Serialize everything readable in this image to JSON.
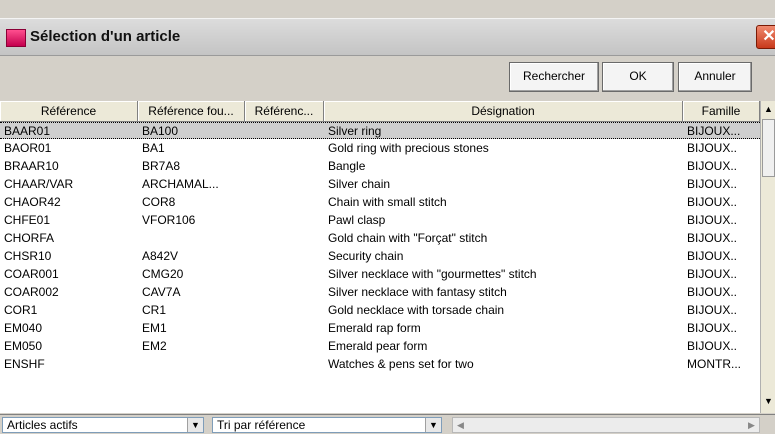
{
  "window": {
    "title": "Sélection d'un article",
    "close_glyph": "✕"
  },
  "toolbar": {
    "search_label": "Rechercher",
    "ok_label": "OK",
    "cancel_label": "Annuler"
  },
  "table": {
    "columns": [
      "Référence",
      "Référence fou...",
      "Référenc...",
      "Désignation",
      "Famille"
    ],
    "rows": [
      [
        "BAAR01",
        "BA100",
        "",
        "Silver ring",
        "BIJOUX..."
      ],
      [
        "BAOR01",
        "BA1",
        "",
        "Gold ring with precious stones",
        "BIJOUX.."
      ],
      [
        "BRAAR10",
        "BR7A8",
        "",
        "Bangle",
        "BIJOUX.."
      ],
      [
        "CHAAR/VAR",
        "ARCHAMAL...",
        "",
        "Silver chain",
        "BIJOUX.."
      ],
      [
        "CHAOR42",
        "COR8",
        "",
        "Chain with small stitch",
        "BIJOUX.."
      ],
      [
        "CHFE01",
        "VFOR106",
        "",
        "Pawl clasp",
        "BIJOUX.."
      ],
      [
        "CHORFA",
        "",
        "",
        "Gold chain with \"Forçat\" stitch",
        "BIJOUX.."
      ],
      [
        "CHSR10",
        "A842V",
        "",
        "Security chain",
        "BIJOUX.."
      ],
      [
        "COAR001",
        "CMG20",
        "",
        "Silver necklace with \"gourmettes\" stitch",
        "BIJOUX.."
      ],
      [
        "COAR002",
        "CAV7A",
        "",
        "Silver necklace with fantasy stitch",
        "BIJOUX.."
      ],
      [
        "COR1",
        "CR1",
        "",
        "Gold necklace with torsade chain",
        "BIJOUX.."
      ],
      [
        "EM040",
        "EM1",
        "",
        "Emerald rap form",
        "BIJOUX.."
      ],
      [
        "EM050",
        "EM2",
        "",
        "Emerald pear form",
        "BIJOUX.."
      ],
      [
        "ENSHF",
        "",
        "",
        "Watches & pens set for two",
        "MONTR..."
      ]
    ],
    "selected_row": 0
  },
  "status": {
    "filter_value": "Articles actifs",
    "sort_value": "Tri par référence"
  }
}
